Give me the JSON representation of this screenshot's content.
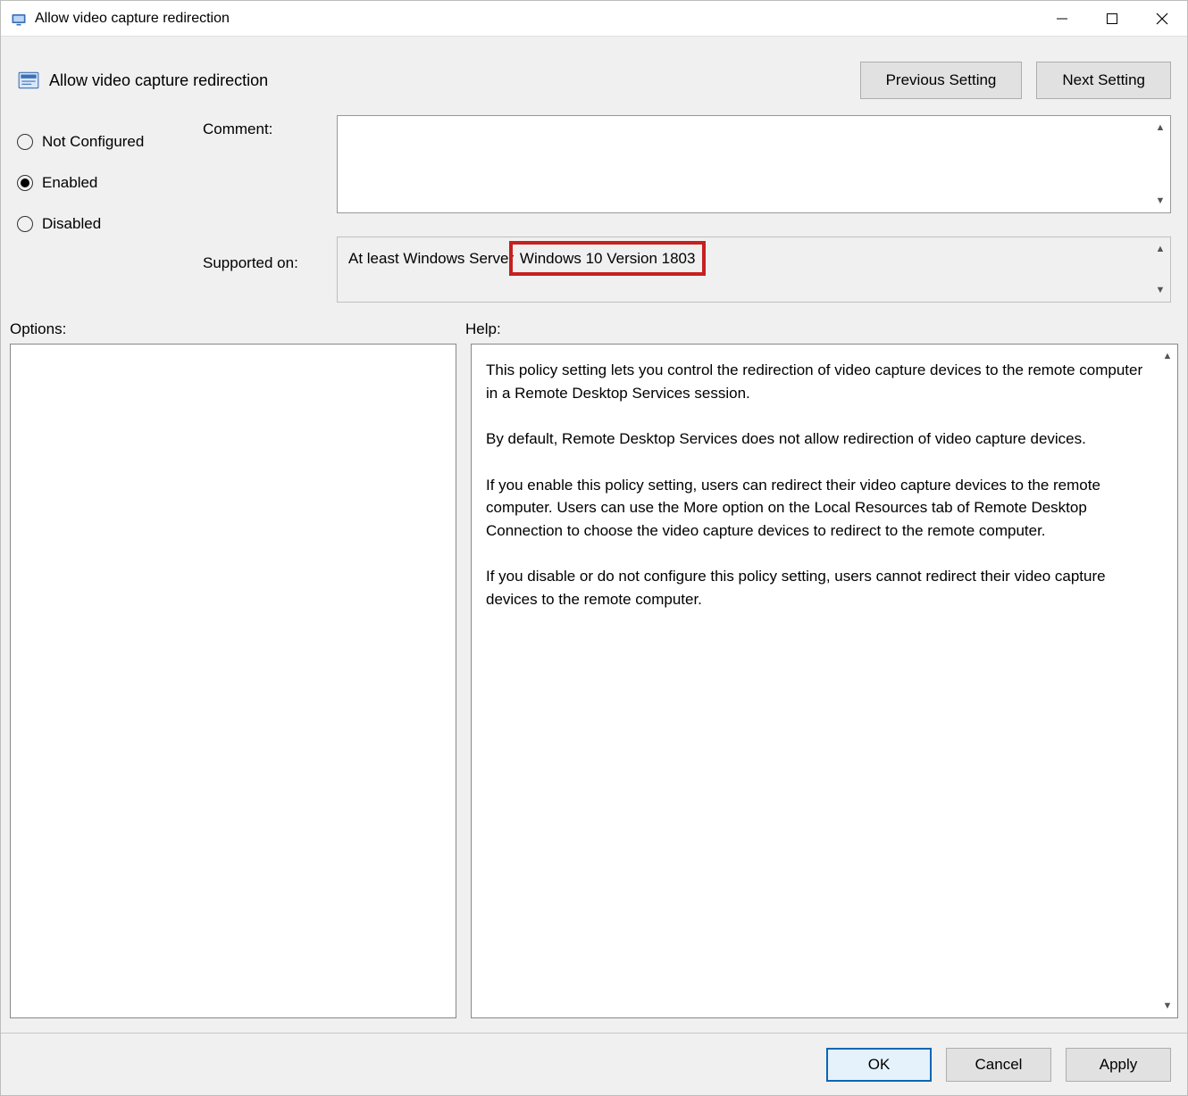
{
  "window": {
    "title": "Allow video capture redirection"
  },
  "header": {
    "policy_name": "Allow video capture redirection",
    "previous_label": "Previous Setting",
    "next_label": "Next Setting"
  },
  "config": {
    "radio_not_configured": "Not Configured",
    "radio_enabled": "Enabled",
    "radio_disabled": "Disabled",
    "selected": "Enabled",
    "comment_label": "Comment:",
    "comment_value": "",
    "supported_label": "Supported on:",
    "supported_pre": "At least Windows Server ",
    "supported_highlight": "Windows 10 Version 1803"
  },
  "sections": {
    "options_label": "Options:",
    "help_label": "Help:"
  },
  "help": {
    "p1": "This policy setting lets you control the redirection of video capture devices to the remote computer in a Remote Desktop Services session.",
    "p2": "By default, Remote Desktop Services does not allow redirection of video capture devices.",
    "p3": "If you enable this policy setting, users can redirect their video capture devices to the remote computer. Users can use the More option on the Local Resources tab of Remote Desktop Connection to choose the video capture devices to redirect to the remote computer.",
    "p4": "If you disable or do not configure this policy setting, users cannot redirect their video capture devices to the remote computer."
  },
  "footer": {
    "ok": "OK",
    "cancel": "Cancel",
    "apply": "Apply"
  },
  "colors": {
    "highlight_border": "#c6201f",
    "focus_border": "#0968b3"
  }
}
